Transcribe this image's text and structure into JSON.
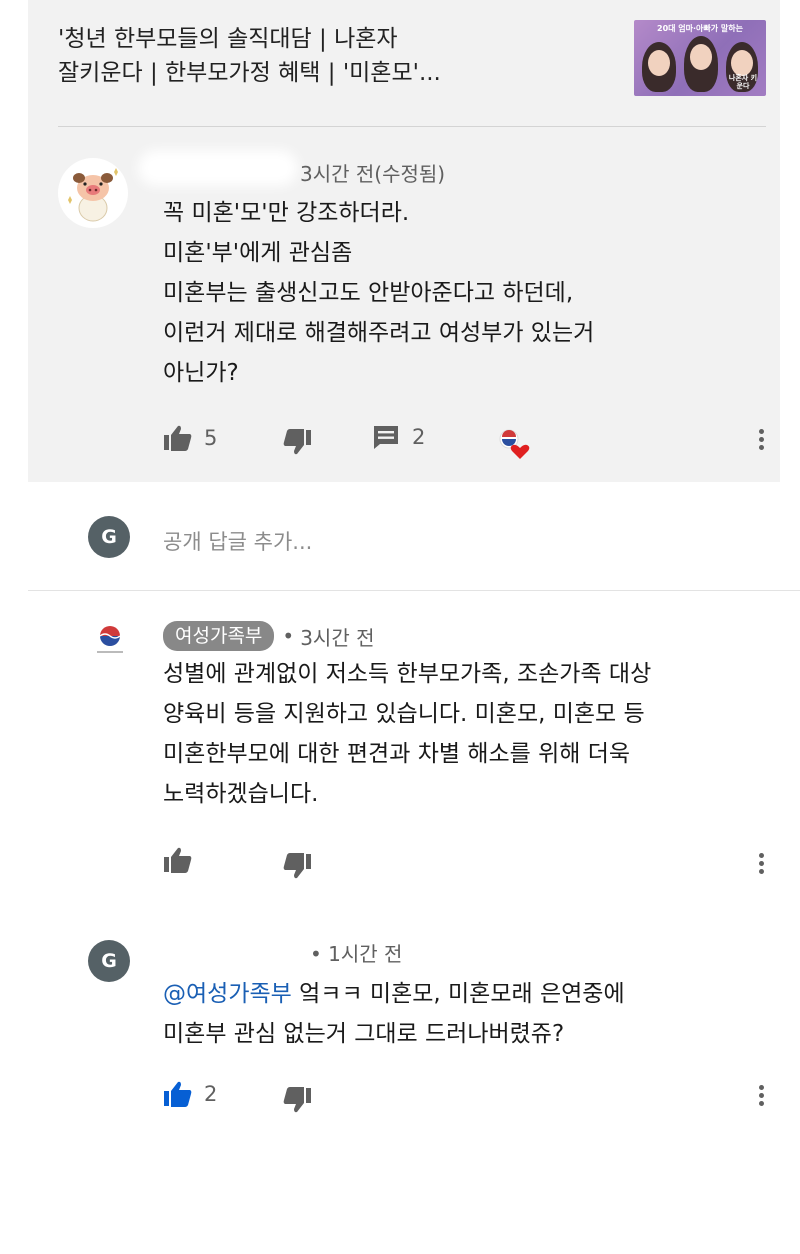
{
  "video": {
    "title_line1": "'청년 한부모들의 솔직대담 | 나혼자",
    "title_line2": "잘키운다 | 한부모가정 혜택 | '미혼모'...",
    "thumbnail": {
      "caption": "20대 엄마·아빠가 말하는",
      "brand": "나혼자 키운다"
    }
  },
  "main_comment": {
    "avatar_icon": "pig-character-avatar",
    "time": "3시간 전(수정됨)",
    "lines": [
      "꼭 미혼'모'만 강조하더라.",
      "미혼'부'에게 관심좀",
      "미혼부는 출생신고도 안받아준다고 하던데,",
      "이런거 제대로 해결해주려고 여성부가 있는거",
      "아닌가?"
    ],
    "likes": "5",
    "replies": "2"
  },
  "reply_box": {
    "avatar_letter": "G",
    "placeholder": "공개 답글 추가..."
  },
  "replies": [
    {
      "author": "여성가족부",
      "separator": "•",
      "time": "3시간 전",
      "lines": [
        "성별에 관계없이 저소득 한부모가족, 조손가족 대상",
        "양육비 등을 지원하고 있습니다. 미혼모, 미혼모 등",
        "미혼한부모에 대한 편견과 차별 해소를 위해 더욱",
        "노력하겠습니다."
      ]
    },
    {
      "avatar_letter": "G",
      "separator": "•",
      "time": "1시간 전",
      "mention": "@여성가족부",
      "line1_rest": " 엌ㅋㅋ 미혼모, 미혼모래 은연중에",
      "line2": "미혼부 관심 없는거 그대로 드러나버렸쥬?",
      "likes": "2"
    }
  ],
  "colors": {
    "highlight_bg": "#f2f2f2",
    "icon_gray": "#606060",
    "liked_blue": "#065fd4",
    "heart_red": "#e02020",
    "chip_gray": "#888888"
  }
}
